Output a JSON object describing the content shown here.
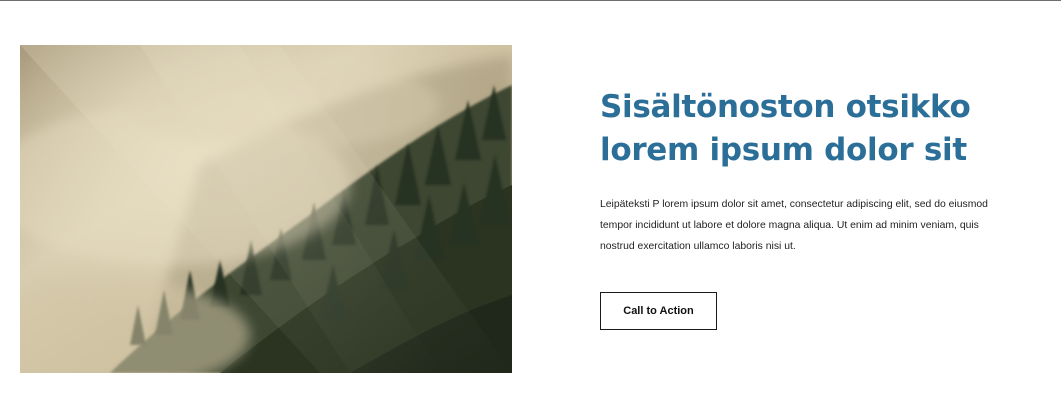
{
  "content_lift": {
    "image": {
      "subject": "misty forest hillside photo",
      "palette": [
        "#c9bb98",
        "#a8987a",
        "#4a4e35",
        "#26301f"
      ]
    },
    "headline_line1": "Sisältönoston otsikko",
    "headline_line2": "lorem ipsum dolor sit",
    "body_line1": "Leipäteksti P lorem ipsum dolor sit amet, consectetur adipiscing elit, sed do eiusmod",
    "body_line2": "tempor incididunt ut labore et dolore magna aliqua. Ut enim ad minim veniam, quis",
    "body_line3": "nostrud exercitation ullamco laboris nisi ut.",
    "cta_label": "Call to Action"
  },
  "colors": {
    "headline": "#2b6f98",
    "body_text": "#1f1f1f",
    "button_border": "#1b1b1b",
    "top_rule": "#6e6e6e"
  }
}
